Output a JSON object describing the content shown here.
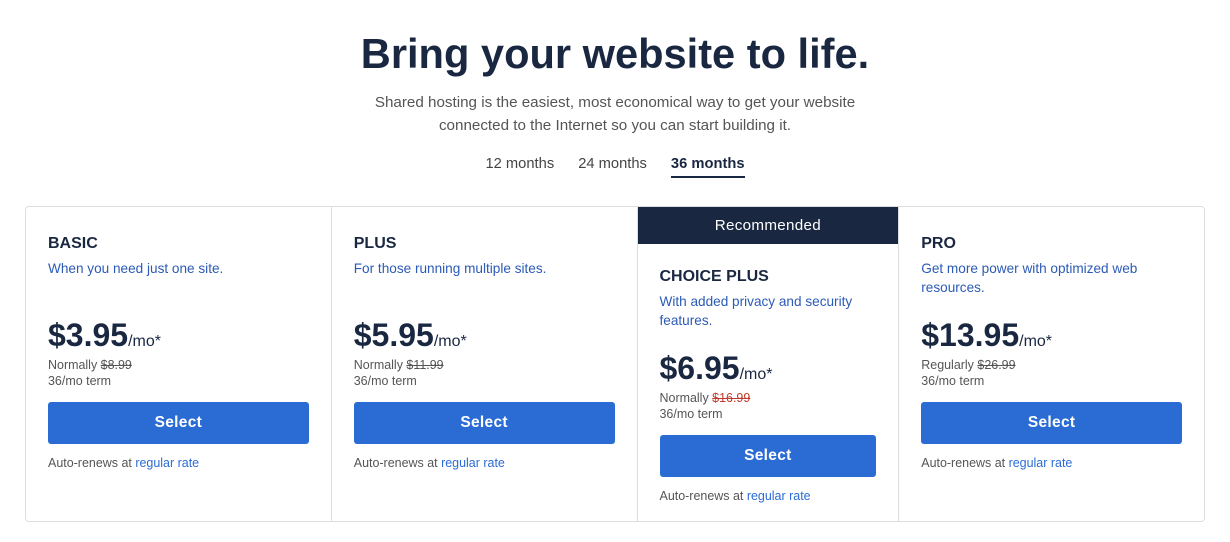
{
  "hero": {
    "title": "Bring your website to life.",
    "subtitle": "Shared hosting is the easiest, most economical way to get your website connected to the Internet so you can start building it."
  },
  "tabs": [
    {
      "label": "12 months",
      "active": false
    },
    {
      "label": "24 months",
      "active": false
    },
    {
      "label": "36 months",
      "active": true
    }
  ],
  "recommended_label": "Recommended",
  "plans": [
    {
      "name": "BASIC",
      "desc": "When you need just one site.",
      "price": "$3.95",
      "price_suffix": "/mo*",
      "normally_label": "Normally",
      "normally_price": "$8.99",
      "normally_red": false,
      "term": "36/mo term",
      "select_label": "Select",
      "auto_renew": "Auto-renews at",
      "auto_renew_link": "regular rate",
      "recommended": false
    },
    {
      "name": "PLUS",
      "desc": "For those running multiple sites.",
      "price": "$5.95",
      "price_suffix": "/mo*",
      "normally_label": "Normally",
      "normally_price": "$11.99",
      "normally_red": false,
      "term": "36/mo term",
      "select_label": "Select",
      "auto_renew": "Auto-renews at",
      "auto_renew_link": "regular rate",
      "recommended": false
    },
    {
      "name": "CHOICE PLUS",
      "desc": "With added privacy and security features.",
      "price": "$6.95",
      "price_suffix": "/mo*",
      "normally_label": "Normally",
      "normally_price": "$16.99",
      "normally_red": true,
      "term": "36/mo term",
      "select_label": "Select",
      "auto_renew": "Auto-renews at",
      "auto_renew_link": "regular rate",
      "recommended": true
    },
    {
      "name": "PRO",
      "desc": "Get more power with optimized web resources.",
      "price": "$13.95",
      "price_suffix": "/mo*",
      "normally_label": "Regularly",
      "normally_price": "$26.99",
      "normally_red": false,
      "term": "36/mo term",
      "select_label": "Select",
      "auto_renew": "Auto-renews at",
      "auto_renew_link": "regular rate",
      "recommended": false
    }
  ]
}
